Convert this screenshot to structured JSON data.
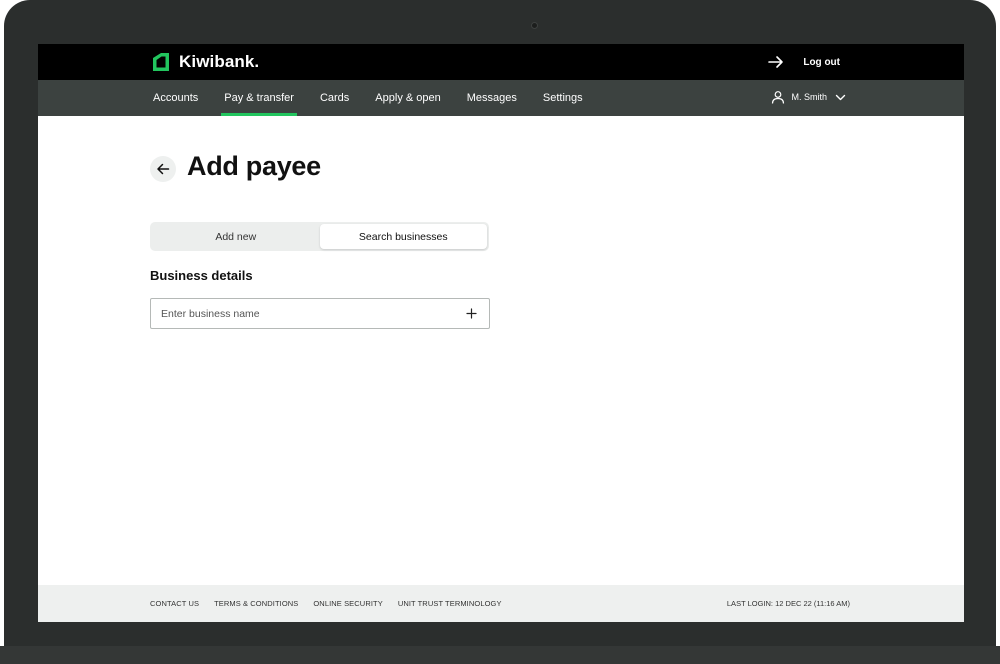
{
  "brand": {
    "name": "Kiwibank.",
    "accent": "#22c55e"
  },
  "topbar": {
    "logout_label": "Log out"
  },
  "nav": {
    "items": [
      {
        "label": "Accounts",
        "active": false
      },
      {
        "label": "Pay & transfer",
        "active": true
      },
      {
        "label": "Cards",
        "active": false
      },
      {
        "label": "Apply & open",
        "active": false
      },
      {
        "label": "Messages",
        "active": false
      },
      {
        "label": "Settings",
        "active": false
      }
    ],
    "user_name": "M. Smith"
  },
  "page": {
    "title": "Add payee",
    "tabs": [
      {
        "label": "Add new",
        "selected": false
      },
      {
        "label": "Search businesses",
        "selected": true
      }
    ],
    "section_heading": "Business details",
    "business_field": {
      "value": "",
      "placeholder": "Enter business name"
    }
  },
  "footer": {
    "links": [
      "CONTACT US",
      "TERMS & CONDITIONS",
      "ONLINE SECURITY",
      "UNIT TRUST TERMINOLOGY"
    ],
    "last_login": "LAST LOGIN: 12 DEC 22 (11:16 AM)"
  },
  "icons": {
    "logo": "kiwibank-logo-icon",
    "logout": "arrow-right-icon",
    "user": "user-icon",
    "chevron": "chevron-down-icon",
    "back": "arrow-left-icon",
    "add": "plus-icon"
  }
}
